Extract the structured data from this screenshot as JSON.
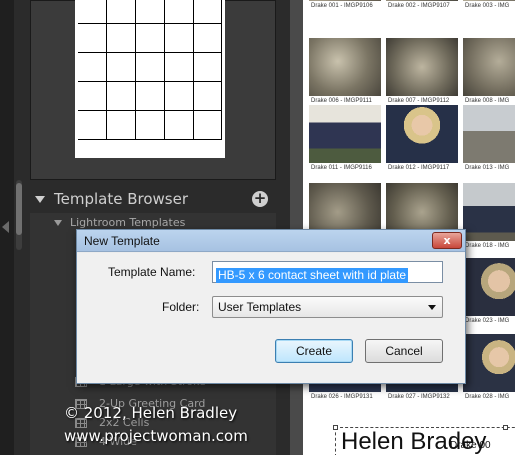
{
  "left_panel": {
    "section_title": "Template Browser",
    "add_symbol": "+",
    "folder": "Lightroom Templates",
    "template_items": [
      "1 Large with Stroke",
      "2-Up Greeting Card",
      "2x2 Cells",
      "4 Wide"
    ]
  },
  "watermark": {
    "line1": "© 2012, Helen Bradley",
    "line2": "www.projectwoman.com"
  },
  "dialog": {
    "title": "New Template",
    "close_symbol": "x",
    "name_label": "Template Name:",
    "name_value": "HB-5 x 6 contact sheet with id plate",
    "folder_label": "Folder:",
    "folder_value": "User Templates",
    "create_label": "Create",
    "cancel_label": "Cancel"
  },
  "contact_sheet": {
    "captions": [
      "Drake 001 - IMGP9106",
      "Drake 002 - IMGP9107",
      "Drake 003 - IMG",
      "Drake 006 - IMGP9111",
      "Drake 007 - IMGP9112",
      "Drake 008 - IMG",
      "Drake 011 - IMGP9116",
      "Drake 012 - IMGP9117",
      "Drake 013 - IMG",
      "Drake 018 - IMG",
      "Drake 023 - IMG",
      "Drake 026 - IMGP9131",
      "Drake 027 - IMGP9132",
      "Drake 028 - IMG"
    ],
    "plate_text": "Helen Bradey",
    "plate_sub": "Drake 00"
  },
  "colors": {
    "panel": "#2b2b2b",
    "dialog_title": "#bcd4ee",
    "selection": "#3399ff"
  }
}
